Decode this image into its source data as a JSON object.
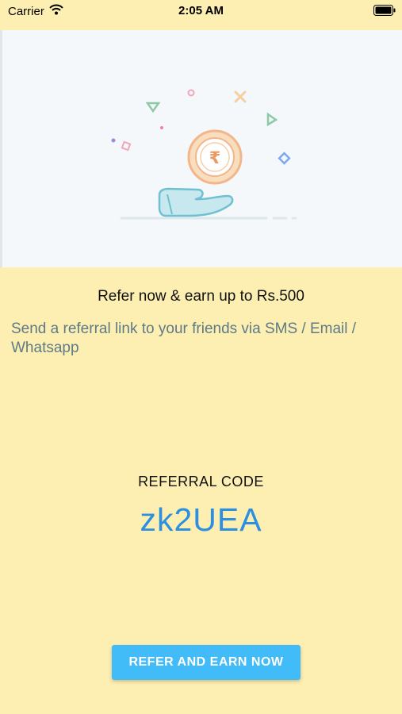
{
  "status_bar": {
    "carrier": "Carrier",
    "time": "2:05 AM"
  },
  "hero": {
    "icons": [
      "rupee-coin-icon",
      "hand-icon"
    ],
    "coin_symbol": "₹"
  },
  "headline": "Refer now & earn up to Rs.500",
  "subtext": "Send a referral link to your friends via SMS / Email / Whatsapp",
  "referral": {
    "label": "REFERRAL CODE",
    "code": "zk2UEA"
  },
  "cta_label": "REFER AND EARN NOW",
  "colors": {
    "background": "#FDEFB2",
    "code_text": "#2D8FE0",
    "button": "#42BCF8",
    "subtext": "#5E7A86"
  }
}
